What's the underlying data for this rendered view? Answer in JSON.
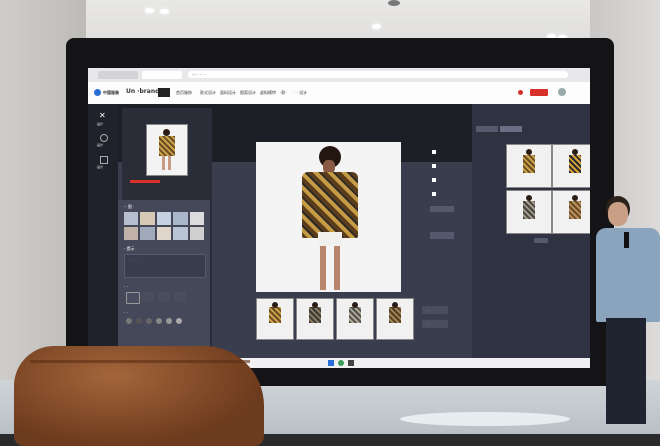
{
  "browser": {
    "url": "·:· ·  ·  ·  ·"
  },
  "header": {
    "logo": "中国服装",
    "brand": "Un ·brand",
    "tabs": [
      "首页服饰",
      "款式设计",
      "面料设计",
      "图案设计",
      "虚拟模特",
      "·款·",
      "· · 设计"
    ],
    "user_label": "·"
  },
  "sidebar": {
    "items": [
      "·设计",
      "·设计",
      "·设计"
    ]
  },
  "left_panel": {
    "section1_title": "·· 图 ·",
    "section2_title": "· 提示",
    "textarea_placeholder": "· · · ·, · · · ·",
    "section3_title": "· ·",
    "section4_title": "· ·",
    "generate_label": "·"
  },
  "toolbar_right": {
    "items": [
      "·",
      "·",
      "·",
      "·",
      "·"
    ]
  },
  "right_panel": {
    "tabs": [
      "·",
      "·"
    ]
  },
  "bottom_buttons": [
    "· ·",
    "· ·"
  ],
  "colors": {
    "accent": "#d8312c",
    "panel": "#3a3d4d",
    "sidebar": "#20222b"
  }
}
